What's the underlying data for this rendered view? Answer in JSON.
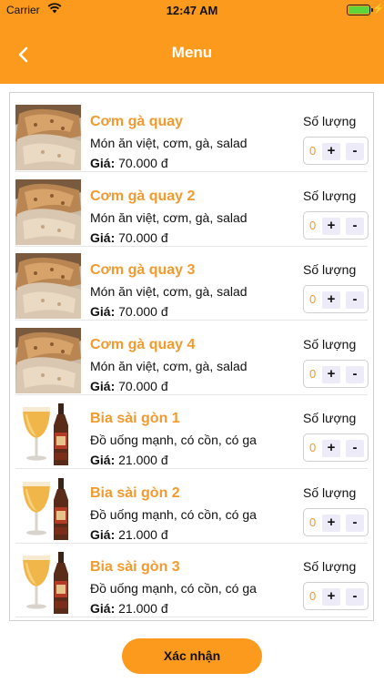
{
  "status_bar": {
    "carrier": "Carrier",
    "time": "12:47 AM",
    "wifi_icon": "wifi-icon",
    "battery_icon": "battery-charging-icon",
    "battery_level": 1.0
  },
  "header": {
    "title": "Menu",
    "back_icon": "chevron-left-icon",
    "background_color": "#fb9a1c"
  },
  "colors": {
    "accent": "#f29a2e",
    "header": "#fb9a1c"
  },
  "menu": {
    "quantity_label": "Số lượng",
    "price_prefix": "Giá:",
    "items": [
      {
        "name": "Cơm gà quay",
        "description": "Món ăn việt, cơm, gà, salad",
        "price": "70.000 đ",
        "quantity": "0",
        "image": "roast-chicken-image"
      },
      {
        "name": "Cơm gà quay 2",
        "description": "Món ăn việt, cơm, gà, salad",
        "price": "70.000 đ",
        "quantity": "0",
        "image": "roast-chicken-image"
      },
      {
        "name": "Cơm gà quay 3",
        "description": "Món ăn việt, cơm, gà, salad",
        "price": "70.000 đ",
        "quantity": "0",
        "image": "roast-chicken-image"
      },
      {
        "name": "Cơm gà quay 4",
        "description": "Món ăn việt, cơm, gà, salad",
        "price": "70.000 đ",
        "quantity": "0",
        "image": "roast-chicken-image"
      },
      {
        "name": "Bia sài gòn 1",
        "description": "Đồ uống mạnh, có cồn, có ga",
        "price": "21.000 đ",
        "quantity": "0",
        "image": "beer-image"
      },
      {
        "name": "Bia sài gòn 2",
        "description": "Đồ uống mạnh, có cồn, có ga",
        "price": "21.000 đ",
        "quantity": "0",
        "image": "beer-image"
      },
      {
        "name": "Bia sài gòn 3",
        "description": "Đồ uống mạnh, có cồn, có ga",
        "price": "21.000 đ",
        "quantity": "0",
        "image": "beer-image"
      }
    ],
    "plus_label": "+",
    "minus_label": "-"
  },
  "footer": {
    "confirm_label": "Xác nhận"
  }
}
